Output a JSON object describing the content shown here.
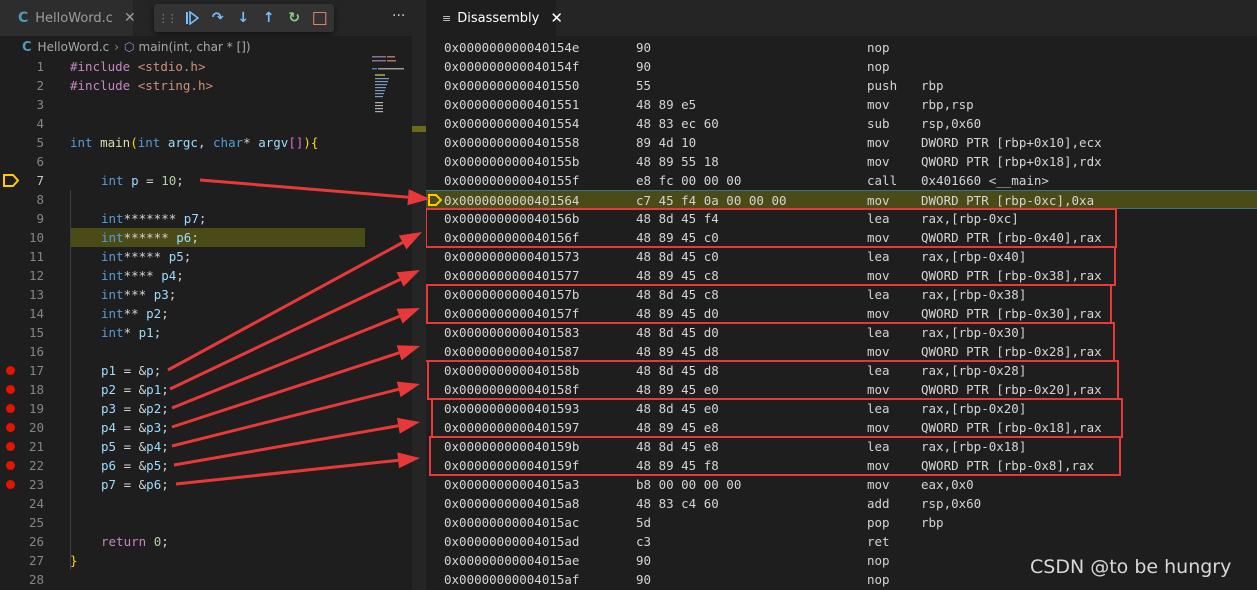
{
  "left_tab": {
    "icon": "C",
    "label": "HelloWord.c",
    "close": "✕"
  },
  "right_tab": {
    "icon": "≡",
    "label": "Disassembly",
    "close": "✕"
  },
  "debug_toolbar": {
    "grip": "⋮⋮",
    "continue": "⊳",
    "step_over": "↷",
    "step_into": "↓",
    "step_out": "↑",
    "restart": "↻",
    "stop": "□",
    "colors": {
      "continue": "#75beff",
      "restart": "#89d185",
      "stop": "#f48771"
    }
  },
  "more_actions": "···",
  "breadcrumb": {
    "file_icon": "C",
    "file": "HelloWord.c",
    "separator": "›",
    "symbol_icon": "⬡",
    "symbol": "main(int, char * [])"
  },
  "code": {
    "line_numbers": [
      "1",
      "2",
      "3",
      "4",
      "5",
      "6",
      "7",
      "8",
      "9",
      "10",
      "11",
      "12",
      "13",
      "14",
      "15",
      "16",
      "17",
      "18",
      "19",
      "20",
      "21",
      "22",
      "23",
      "24",
      "25",
      "26",
      "27",
      "28"
    ],
    "lines": [
      "#include <stdio.h>",
      "#include <string.h>",
      "",
      "",
      "int main(int argc, char* argv[]){",
      "",
      "int p = 10;",
      "",
      "int******* p7;",
      "int****** p6;",
      "int***** p5;",
      "int**** p4;",
      "int*** p3;",
      "int** p2;",
      "int* p1;",
      "",
      "p1 = &p;",
      "p2 = &p1;",
      "p3 = &p2;",
      "p4 = &p3;",
      "p5 = &p4;",
      "p6 = &p5;",
      "p7 = &p6;",
      "",
      "",
      "return 0;",
      "}",
      ""
    ],
    "current_line": "7",
    "breakpoint_lines": [
      "17",
      "18",
      "19",
      "20",
      "21",
      "22",
      "23"
    ]
  },
  "disassembly": {
    "rows": [
      {
        "addr": "0x000000000040154e",
        "bytes": "90",
        "mnem": "nop",
        "ops": ""
      },
      {
        "addr": "0x000000000040154f",
        "bytes": "90",
        "mnem": "nop",
        "ops": ""
      },
      {
        "addr": "0x0000000000401550",
        "bytes": "55",
        "mnem": "push",
        "ops": "rbp"
      },
      {
        "addr": "0x0000000000401551",
        "bytes": "48 89 e5",
        "mnem": "mov",
        "ops": "rbp,rsp"
      },
      {
        "addr": "0x0000000000401554",
        "bytes": "48 83 ec 60",
        "mnem": "sub",
        "ops": "rsp,0x60"
      },
      {
        "addr": "0x0000000000401558",
        "bytes": "89 4d 10",
        "mnem": "mov",
        "ops": "DWORD PTR [rbp+0x10],ecx"
      },
      {
        "addr": "0x000000000040155b",
        "bytes": "48 89 55 18",
        "mnem": "mov",
        "ops": "QWORD PTR [rbp+0x18],rdx"
      },
      {
        "addr": "0x000000000040155f",
        "bytes": "e8 fc 00 00 00",
        "mnem": "call",
        "ops": "0x401660 <__main>"
      },
      {
        "addr": "0x0000000000401564",
        "bytes": "c7 45 f4 0a 00 00 00",
        "mnem": "mov",
        "ops": "DWORD PTR [rbp-0xc],0xa"
      },
      {
        "addr": "0x000000000040156b",
        "bytes": "48 8d 45 f4",
        "mnem": "lea",
        "ops": "rax,[rbp-0xc]"
      },
      {
        "addr": "0x000000000040156f",
        "bytes": "48 89 45 c0",
        "mnem": "mov",
        "ops": "QWORD PTR [rbp-0x40],rax"
      },
      {
        "addr": "0x0000000000401573",
        "bytes": "48 8d 45 c0",
        "mnem": "lea",
        "ops": "rax,[rbp-0x40]"
      },
      {
        "addr": "0x0000000000401577",
        "bytes": "48 89 45 c8",
        "mnem": "mov",
        "ops": "QWORD PTR [rbp-0x38],rax"
      },
      {
        "addr": "0x000000000040157b",
        "bytes": "48 8d 45 c8",
        "mnem": "lea",
        "ops": "rax,[rbp-0x38]"
      },
      {
        "addr": "0x000000000040157f",
        "bytes": "48 89 45 d0",
        "mnem": "mov",
        "ops": "QWORD PTR [rbp-0x30],rax"
      },
      {
        "addr": "0x0000000000401583",
        "bytes": "48 8d 45 d0",
        "mnem": "lea",
        "ops": "rax,[rbp-0x30]"
      },
      {
        "addr": "0x0000000000401587",
        "bytes": "48 89 45 d8",
        "mnem": "mov",
        "ops": "QWORD PTR [rbp-0x28],rax"
      },
      {
        "addr": "0x000000000040158b",
        "bytes": "48 8d 45 d8",
        "mnem": "lea",
        "ops": "rax,[rbp-0x28]"
      },
      {
        "addr": "0x000000000040158f",
        "bytes": "48 89 45 e0",
        "mnem": "mov",
        "ops": "QWORD PTR [rbp-0x20],rax"
      },
      {
        "addr": "0x0000000000401593",
        "bytes": "48 8d 45 e0",
        "mnem": "lea",
        "ops": "rax,[rbp-0x20]"
      },
      {
        "addr": "0x0000000000401597",
        "bytes": "48 89 45 e8",
        "mnem": "mov",
        "ops": "QWORD PTR [rbp-0x18],rax"
      },
      {
        "addr": "0x000000000040159b",
        "bytes": "48 8d 45 e8",
        "mnem": "lea",
        "ops": "rax,[rbp-0x18]"
      },
      {
        "addr": "0x000000000040159f",
        "bytes": "48 89 45 f8",
        "mnem": "mov",
        "ops": "QWORD PTR [rbp-0x8],rax"
      },
      {
        "addr": "0x00000000004015a3",
        "bytes": "b8 00 00 00 00",
        "mnem": "mov",
        "ops": "eax,0x0"
      },
      {
        "addr": "0x00000000004015a8",
        "bytes": "48 83 c4 60",
        "mnem": "add",
        "ops": "rsp,0x60"
      },
      {
        "addr": "0x00000000004015ac",
        "bytes": "5d",
        "mnem": "pop",
        "ops": "rbp"
      },
      {
        "addr": "0x00000000004015ad",
        "bytes": "c3",
        "mnem": "ret",
        "ops": ""
      },
      {
        "addr": "0x00000000004015ae",
        "bytes": "90",
        "mnem": "nop",
        "ops": ""
      },
      {
        "addr": "0x00000000004015af",
        "bytes": "90",
        "mnem": "nop",
        "ops": ""
      }
    ],
    "current_addr": "0x0000000000401564"
  },
  "annotation_color": "#e8393a",
  "watermark": "CSDN @to be hungry"
}
